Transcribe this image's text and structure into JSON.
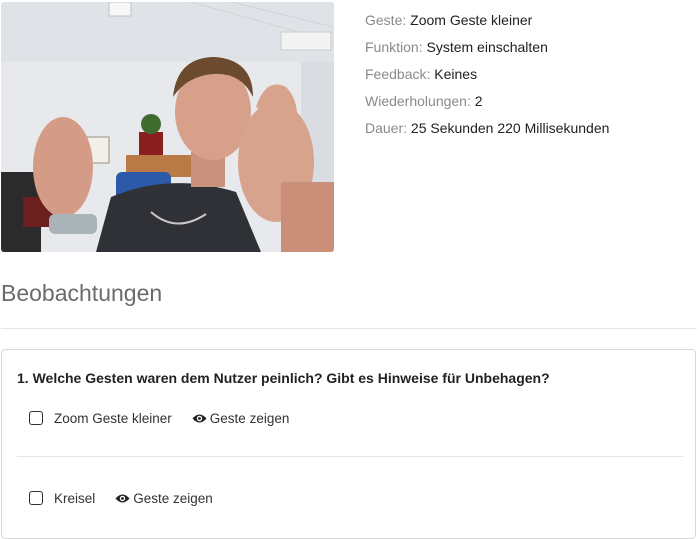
{
  "gesture_info": {
    "geste": {
      "label": "Geste:",
      "value": "Zoom Geste kleiner"
    },
    "funktion": {
      "label": "Funktion:",
      "value": "System einschalten"
    },
    "feedback": {
      "label": "Feedback:",
      "value": "Keines"
    },
    "wiederholungen": {
      "label": "Wiederholungen:",
      "value": "2"
    },
    "dauer": {
      "label": "Dauer:",
      "value": "25 Sekunden 220 Millisekunden"
    }
  },
  "observations": {
    "title": "Beobachtungen",
    "question": "1. Welche Gesten waren dem Nutzer peinlich? Gibt es Hinweise für Unbehagen?",
    "options": [
      {
        "label": "Zoom Geste kleiner",
        "show_label": "Geste zeigen",
        "checked": false
      },
      {
        "label": "Kreisel",
        "show_label": "Geste zeigen",
        "checked": false
      }
    ]
  },
  "icons": {
    "show": "eye-icon"
  }
}
